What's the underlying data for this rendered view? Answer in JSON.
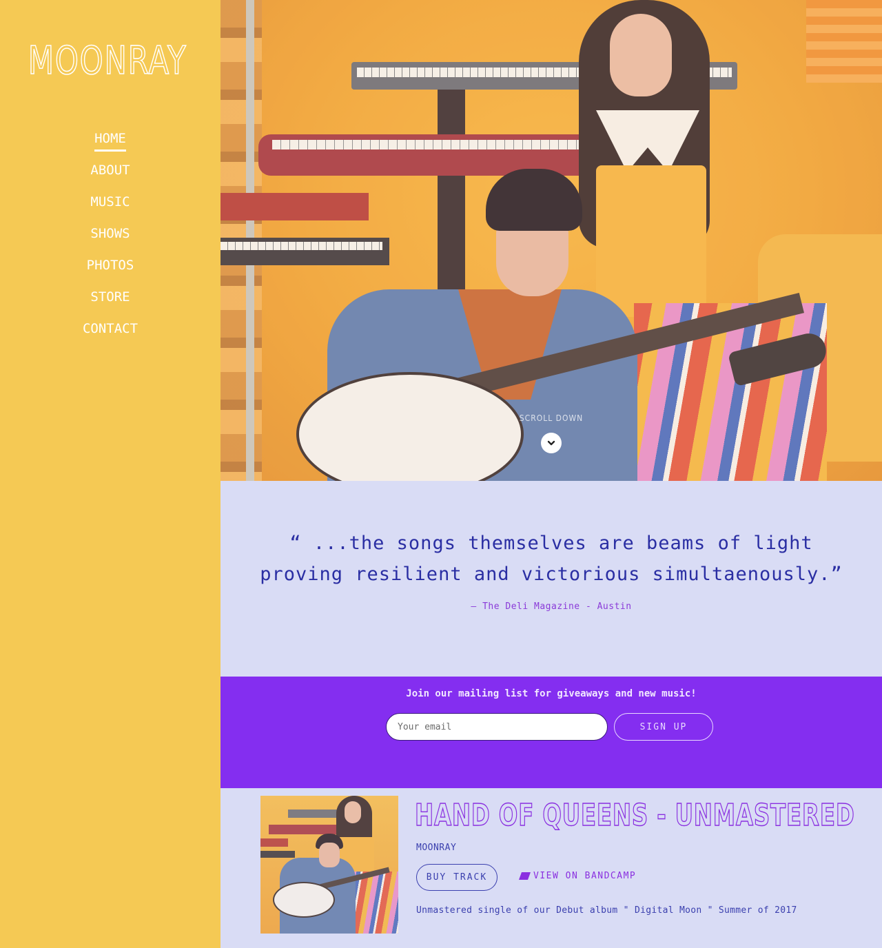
{
  "brand": {
    "logo": "MOONRAY"
  },
  "colors": {
    "sidebar_bg": "#f5c954",
    "page_bg": "#d9dcf5",
    "mailing_bg": "#842ef0",
    "quote_text": "#2a2ea3",
    "accent_purple": "#8a2fe0"
  },
  "nav": {
    "items": [
      {
        "label": "HOME",
        "active": true
      },
      {
        "label": "ABOUT",
        "active": false
      },
      {
        "label": "MUSIC",
        "active": false
      },
      {
        "label": "SHOWS",
        "active": false
      },
      {
        "label": "PHOTOS",
        "active": false
      },
      {
        "label": "STORE",
        "active": false
      },
      {
        "label": "CONTACT",
        "active": false
      }
    ]
  },
  "hero": {
    "image_alt": "Band photo of Moonray duo with keyboards and guitar",
    "scroll_label": "SCROLL DOWN",
    "scroll_icon": "chevron-down-icon"
  },
  "quote": {
    "text": "“ ...the songs themselves are beams of light proving resilient and victorious simultaenously.”",
    "source": "— The Deli Magazine - Austin"
  },
  "mailing": {
    "title": "Join our mailing list for giveaways and new music!",
    "email_placeholder": "Your email",
    "email_value": "",
    "signup_label": "SIGN UP"
  },
  "track": {
    "title": "HAND OF QUEENS - UNMASTERED",
    "artist": "MOONRAY",
    "buy_label": "BUY TRACK",
    "bandcamp_label": "VIEW ON BANDCAMP",
    "bandcamp_icon": "bandcamp-icon",
    "description": "Unmastered single of our Debut album \" Digital Moon \" Summer of 2017",
    "art_alt": "Hand of Queens single cover art"
  }
}
